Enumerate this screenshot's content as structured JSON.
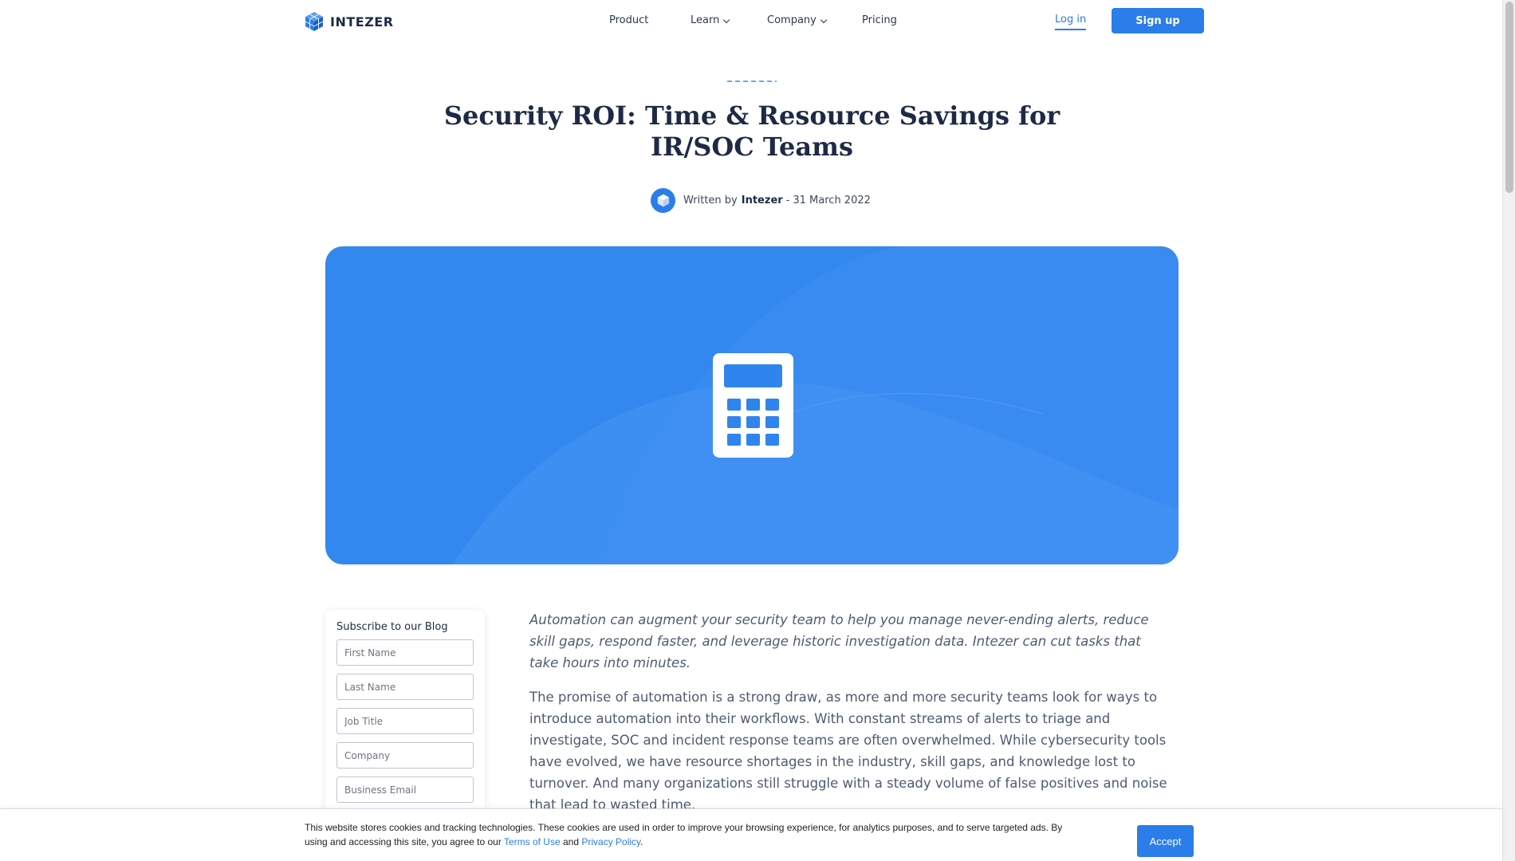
{
  "header": {
    "brand": "INTEZER",
    "nav": [
      {
        "label": "Product"
      },
      {
        "label": "Learn"
      },
      {
        "label": "Company"
      },
      {
        "label": "Pricing"
      }
    ],
    "login_label": "Log in",
    "signup_label": "Sign up"
  },
  "article": {
    "title": "Security ROI: Time & Resource Savings for IR/SOC Teams",
    "byline_prefix": "Written by",
    "author": "Intezer",
    "date_sep": "-",
    "date": "31 March 2022",
    "hero_icon": "calculator-icon",
    "lead": "Automation can augment your security team to help you manage never-ending alerts, reduce skill gaps, respond faster, and leverage historic investigation data. Intezer can cut tasks that take hours into minutes.",
    "paragraph": "The promise of automation is a strong draw, as more and more security teams look for ways to introduce automation into their workflows. With constant streams of alerts to triage and investigate, SOC and incident response teams are often overwhelmed. While cybersecurity tools have evolved, we have resource shortages in the industry, skill gaps, and knowledge lost to turnover. And many organizations still struggle with a steady volume of false positives and noise that lead to wasted time."
  },
  "subscribe": {
    "heading": "Subscribe to our Blog",
    "fields": [
      {
        "placeholder": "First Name"
      },
      {
        "placeholder": "Last Name"
      },
      {
        "placeholder": "Job Title"
      },
      {
        "placeholder": "Company"
      },
      {
        "placeholder": "Business Email"
      }
    ]
  },
  "cookie": {
    "text_1": "This website stores cookies and tracking technologies. These cookies are used in order to improve your browsing experience, for analytics purposes, and to serve targeted ads. By using and accessing this site, you agree to our",
    "terms_link": "Terms of Use",
    "and": "and",
    "privacy_link": "Privacy Policy",
    "end": ".",
    "accept_label": "Accept"
  },
  "colors": {
    "accent": "#2b7de9",
    "hero": "#3388f0",
    "text_dark": "#1e2a45"
  }
}
